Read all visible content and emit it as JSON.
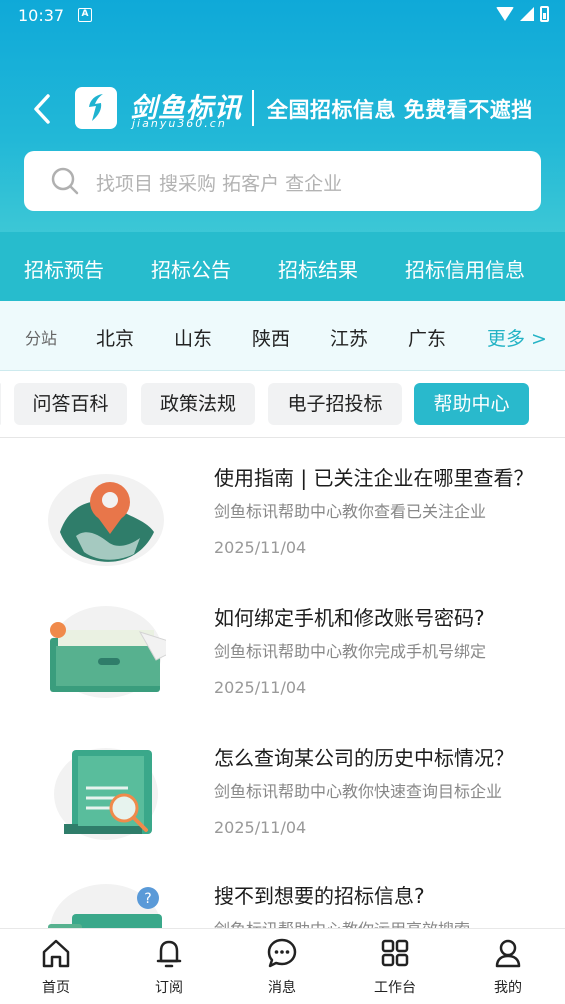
{
  "status_bar": {
    "time": "10:37",
    "notification_icon": "A"
  },
  "header": {
    "back_icon": "chevron-left-icon",
    "logo_name": "剑鱼标讯",
    "logo_sub": "jianyu360.cn",
    "slogan": "全国招标信息 免费看不遮挡"
  },
  "search": {
    "placeholder": "找项目 搜采购 拓客户 查企业"
  },
  "categories": [
    "招标预告",
    "招标公告",
    "招标结果",
    "招标信用信息"
  ],
  "regions": {
    "label": "分站",
    "items": [
      "北京",
      "山东",
      "陕西",
      "江苏",
      "广东"
    ],
    "more": "更多 >"
  },
  "chips": {
    "items": [
      "问答百科",
      "政策法规",
      "电子招投标",
      "帮助中心"
    ],
    "active": "帮助中心"
  },
  "articles": [
    {
      "title": "使用指南 | 已关注企业在哪里查看？",
      "desc": "剑鱼标讯帮助中心教你查看已关注企业",
      "date": "2025/11/04",
      "icon": "map-pin-icon"
    },
    {
      "title": "如何绑定手机和修改账号密码?",
      "desc": "剑鱼标讯帮助中心教你完成手机号绑定",
      "date": "2025/11/04",
      "icon": "envelope-icon"
    },
    {
      "title": "怎么查询某公司的历史中标情况？",
      "desc": "剑鱼标讯帮助中心教你快速查询目标企业",
      "date": "2025/11/04",
      "icon": "document-search-icon"
    },
    {
      "title": "搜不到想要的招标信息?",
      "desc": "剑鱼标讯帮助中心教你运用高效搜索",
      "date": "",
      "icon": "help-screen-icon"
    }
  ],
  "bottom_nav": [
    {
      "label": "首页",
      "icon": "home-icon"
    },
    {
      "label": "订阅",
      "icon": "bell-icon"
    },
    {
      "label": "消息",
      "icon": "chat-icon"
    },
    {
      "label": "工作台",
      "icon": "grid-icon"
    },
    {
      "label": "我的",
      "icon": "user-icon"
    }
  ],
  "colors": {
    "brand": "#1fb3d0",
    "accent": "#29b9cc",
    "region_more": "#24b3c5"
  }
}
